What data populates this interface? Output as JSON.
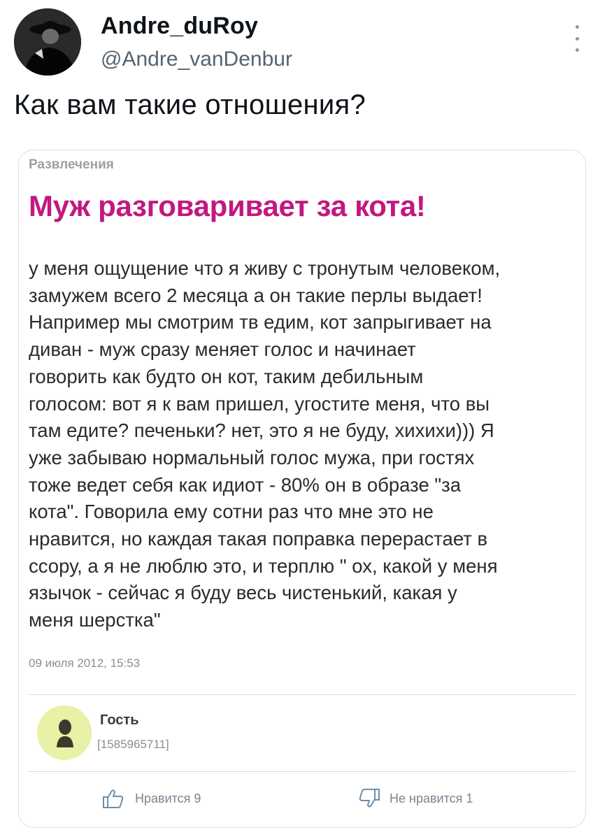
{
  "tweet": {
    "display_name": "Andre_duRoy",
    "handle": "@Andre_vanDenbur",
    "avatar_icon": "user-avatar-photo",
    "more_icon": "more-vertical-icon",
    "text": "Как вам такие отношения?"
  },
  "card": {
    "category": "Развлечения",
    "headline": "Муж разговаривает за кота!",
    "headline_color": "#c2187f",
    "body": "у меня ощущение что я живу с тронутым человеком,\nзамужем всего 2 месяца а он такие перлы выдает!\nНапример мы смотрим тв едим, кот запрыгивает на\nдиван - муж сразу меняет голос и начинает\nговорить как будто он кот, таким дебильным\nголосом: вот я к вам пришел, угостите меня, что вы\nтам едите? печеньки? нет, это я не буду, хихихи))) Я\nуже забываю нормальный голос мужа, при гостях\nтоже ведет себя как идиот - 80% он в образе \"за\nкота\". Говорила ему сотни раз что мне это не\nнравится, но каждая такая поправка перерастает в\nссору, а я не люблю это, и терплю \" ох, какой у меня\nязычок - сейчас я буду весь чистенький, какая у\nменя шерстка\"",
    "date": "09 июля 2012, 15:53",
    "author": {
      "name": "Гость",
      "id": "[1585965711]",
      "avatar_color": "#e8f1a6",
      "avatar_icon": "guest-user-icon"
    },
    "reactions": {
      "like_label": "Нравится 9",
      "like_icon": "thumbs-up-icon",
      "dislike_label": "Не нравится 1",
      "dislike_icon": "thumbs-down-icon"
    }
  }
}
